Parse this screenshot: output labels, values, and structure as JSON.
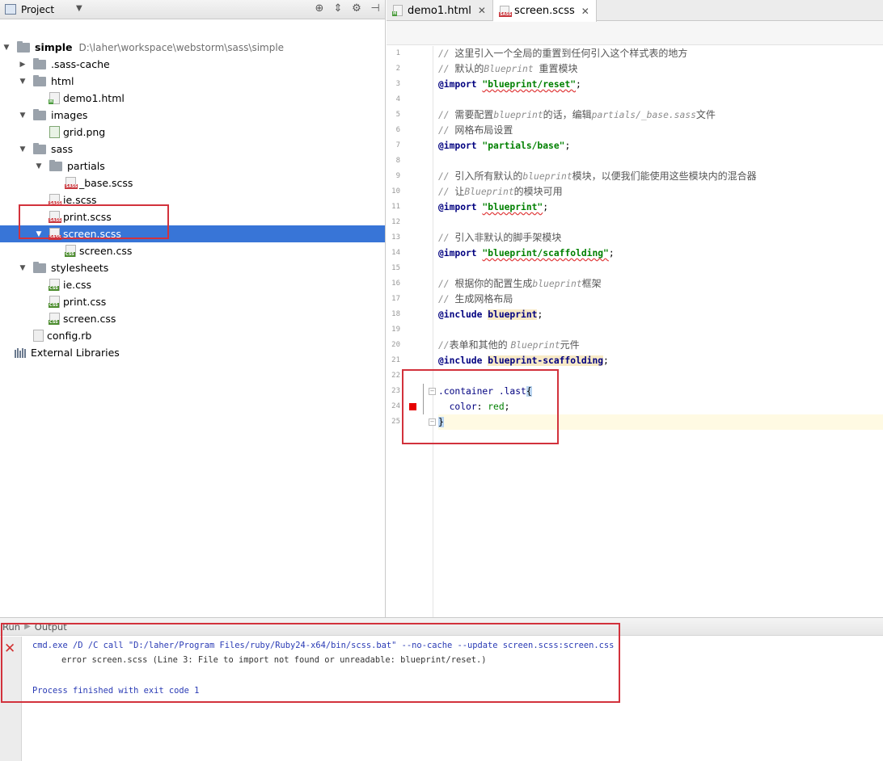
{
  "project_panel": {
    "title": "Project",
    "tree": [
      {
        "name": "simple",
        "path": "D:\\laher\\workspace\\webstorm\\sass\\simple",
        "type": "folder",
        "expanded": true,
        "indent": 0,
        "bold": true
      },
      {
        "name": ".sass-cache",
        "type": "folder",
        "expanded": false,
        "indent": 1
      },
      {
        "name": "html",
        "type": "folder",
        "expanded": true,
        "indent": 1
      },
      {
        "name": "demo1.html",
        "type": "html",
        "indent": 2
      },
      {
        "name": "images",
        "type": "folder",
        "expanded": true,
        "indent": 1
      },
      {
        "name": "grid.png",
        "type": "img",
        "indent": 2
      },
      {
        "name": "sass",
        "type": "folder",
        "expanded": true,
        "indent": 1
      },
      {
        "name": "partials",
        "type": "folder",
        "expanded": true,
        "indent": 2
      },
      {
        "name": "_base.scss",
        "type": "sass",
        "indent": 3
      },
      {
        "name": "ie.scss",
        "type": "sass",
        "indent": 2
      },
      {
        "name": "print.scss",
        "type": "sass",
        "indent": 2
      },
      {
        "name": "screen.scss",
        "type": "sass",
        "expanded": true,
        "indent": 2,
        "selected": true
      },
      {
        "name": "screen.css",
        "type": "css",
        "indent": 3
      },
      {
        "name": "stylesheets",
        "type": "folder",
        "expanded": true,
        "indent": 1
      },
      {
        "name": "ie.css",
        "type": "css",
        "indent": 2
      },
      {
        "name": "print.css",
        "type": "css",
        "indent": 2
      },
      {
        "name": "screen.css",
        "type": "css",
        "indent": 2
      },
      {
        "name": "config.rb",
        "type": "rb",
        "indent": 1
      },
      {
        "name": "External Libraries",
        "type": "libs",
        "indent": 0
      }
    ]
  },
  "editor": {
    "tabs": [
      {
        "label": "demo1.html",
        "icon": "html-file-icon",
        "active": false
      },
      {
        "label": "screen.scss",
        "icon": "sass-file-icon",
        "active": true
      }
    ],
    "lines": [
      {
        "n": "1",
        "segs": [
          [
            "cmt",
            "// "
          ],
          [
            "cmtzh",
            "这里引入一个全局的重置到任何引入这个样式表的地方"
          ]
        ]
      },
      {
        "n": "2",
        "segs": [
          [
            "cmt",
            "// "
          ],
          [
            "cmtzh",
            "默认的"
          ],
          [
            "cmt",
            "Blueprint "
          ],
          [
            "cmtzh",
            "重置模块"
          ]
        ]
      },
      {
        "n": "3",
        "segs": [
          [
            "kw",
            "@import "
          ],
          [
            "str",
            "\"blueprint/reset\""
          ],
          [
            "plain",
            ";"
          ]
        ]
      },
      {
        "n": "4",
        "segs": []
      },
      {
        "n": "5",
        "segs": [
          [
            "cmt",
            "// "
          ],
          [
            "cmtzh",
            "需要配置"
          ],
          [
            "cmt",
            "blueprint"
          ],
          [
            "cmtzh",
            "的话，编辑"
          ],
          [
            "cmt",
            "partials/_base.sass"
          ],
          [
            "cmtzh",
            "文件"
          ]
        ]
      },
      {
        "n": "6",
        "segs": [
          [
            "cmt",
            "// "
          ],
          [
            "cmtzh",
            "网格布局设置"
          ]
        ]
      },
      {
        "n": "7",
        "segs": [
          [
            "kw",
            "@import "
          ],
          [
            "strok",
            "\"partials/base\""
          ],
          [
            "plain",
            ";"
          ]
        ]
      },
      {
        "n": "8",
        "segs": []
      },
      {
        "n": "9",
        "segs": [
          [
            "cmt",
            "// "
          ],
          [
            "cmtzh",
            "引入所有默认的"
          ],
          [
            "cmt",
            "blueprint"
          ],
          [
            "cmtzh",
            "模块，以便我们能使用这些模块内的混合器"
          ]
        ]
      },
      {
        "n": "10",
        "segs": [
          [
            "cmt",
            "// "
          ],
          [
            "cmtzh",
            "让"
          ],
          [
            "cmt",
            "Blueprint"
          ],
          [
            "cmtzh",
            "的模块可用"
          ]
        ]
      },
      {
        "n": "11",
        "segs": [
          [
            "kw",
            "@import "
          ],
          [
            "str",
            "\"blueprint\""
          ],
          [
            "plain",
            ";"
          ]
        ]
      },
      {
        "n": "12",
        "segs": []
      },
      {
        "n": "13",
        "segs": [
          [
            "cmt",
            "// "
          ],
          [
            "cmtzh",
            "引入非默认的脚手架模块"
          ]
        ]
      },
      {
        "n": "14",
        "segs": [
          [
            "kw",
            "@import "
          ],
          [
            "str",
            "\"blueprint/scaffolding\""
          ],
          [
            "plain",
            ";"
          ]
        ]
      },
      {
        "n": "15",
        "segs": []
      },
      {
        "n": "16",
        "segs": [
          [
            "cmt",
            "// "
          ],
          [
            "cmtzh",
            "根据你的配置生成"
          ],
          [
            "cmt",
            "blueprint"
          ],
          [
            "cmtzh",
            "框架"
          ]
        ]
      },
      {
        "n": "17",
        "segs": [
          [
            "cmt",
            "// "
          ],
          [
            "cmtzh",
            "生成网格布局"
          ]
        ]
      },
      {
        "n": "18",
        "segs": [
          [
            "kw",
            "@include "
          ],
          [
            "inc",
            "blueprint"
          ],
          [
            "plain",
            ";"
          ]
        ]
      },
      {
        "n": "19",
        "segs": []
      },
      {
        "n": "20",
        "segs": [
          [
            "cmt",
            "//"
          ],
          [
            "cmtzh",
            "表单和其他的 "
          ],
          [
            "cmt",
            "Blueprint"
          ],
          [
            "cmtzh",
            "元件"
          ]
        ]
      },
      {
        "n": "21",
        "segs": [
          [
            "kw",
            "@include "
          ],
          [
            "inc",
            "blueprint-scaffolding"
          ],
          [
            "plain",
            ";"
          ]
        ]
      },
      {
        "n": "22",
        "segs": []
      },
      {
        "n": "23",
        "segs": [
          [
            "sel",
            ".container .last"
          ],
          [
            "brace",
            "{"
          ]
        ]
      },
      {
        "n": "24",
        "segs": [
          [
            "plain",
            "  "
          ],
          [
            "prop",
            "color"
          ],
          [
            "plain",
            ": "
          ],
          [
            "val",
            "red"
          ],
          [
            "plain",
            ";"
          ]
        ]
      },
      {
        "n": "25",
        "segs": [
          [
            "brace",
            "}"
          ]
        ],
        "caret": true
      }
    ]
  },
  "run_panel": {
    "label": "Run",
    "tab": "Output",
    "cmd": "cmd.exe /D /C call \"D:/laher/Program Files/ruby/Ruby24-x64/bin/scss.bat\" --no-cache --update screen.scss:screen.css",
    "error": "error screen.scss (Line 3: File to import not found or unreadable: blueprint/reset.)",
    "exit": "Process finished with exit code 1"
  }
}
